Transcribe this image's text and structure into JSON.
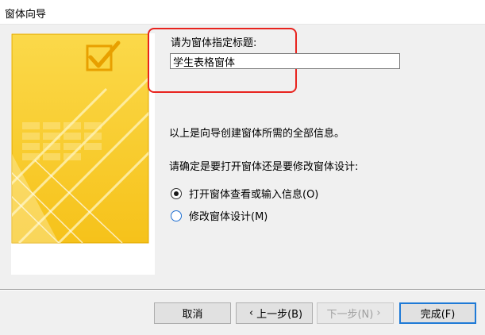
{
  "window": {
    "title": "窗体向导"
  },
  "prompt": {
    "label": "请为窗体指定标题:",
    "value": "学生表格窗体"
  },
  "info_text": "以上是向导创建窗体所需的全部信息。",
  "question_text": "请确定是要打开窗体还是要修改窗体设计:",
  "options": [
    {
      "label": "打开窗体查看或输入信息(O)",
      "checked": true
    },
    {
      "label": "修改窗体设计(M)",
      "checked": false
    }
  ],
  "buttons": {
    "cancel": "取消",
    "back": "上一步(B)",
    "next": "下一步(N)",
    "finish": "完成(F)",
    "back_arrow": "‹",
    "next_arrow": "›"
  },
  "colors": {
    "highlight_border": "#e8231e",
    "art_yellow": "#f7cc2f",
    "default_button_border": "#1f7ad6"
  }
}
